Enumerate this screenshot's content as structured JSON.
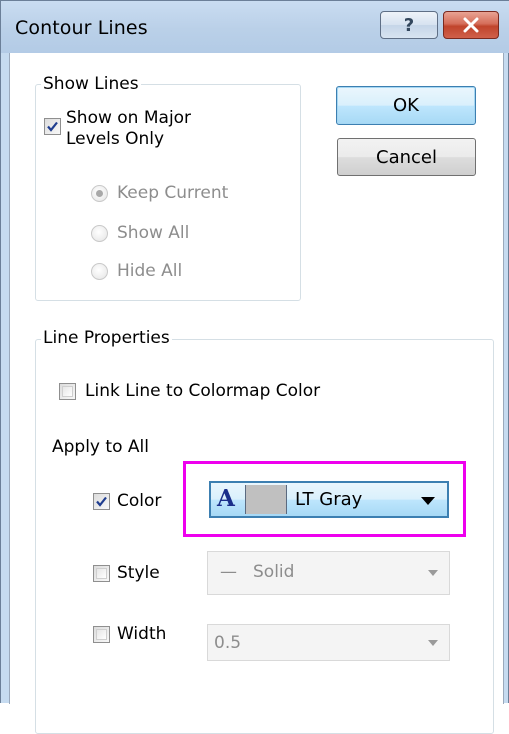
{
  "dialog": {
    "title": "Contour Lines",
    "help_label": "?"
  },
  "show_lines": {
    "group_label": "Show Lines",
    "major_only_line1": "Show on Major",
    "major_only_line2": "Levels Only",
    "major_only_checked": true,
    "radios": [
      {
        "label": "Keep Current",
        "selected": true
      },
      {
        "label": "Show All",
        "selected": false
      },
      {
        "label": "Hide All",
        "selected": false
      }
    ]
  },
  "buttons": {
    "ok": "OK",
    "cancel": "Cancel"
  },
  "line_properties": {
    "group_label": "Line Properties",
    "link_colormap_label": "Link Line to Colormap Color",
    "link_colormap_checked": false,
    "apply_all_label": "Apply to All",
    "color": {
      "label": "Color",
      "checked": true,
      "value": "LT Gray",
      "font_glyph": "A",
      "swatch": "#c0c0c0"
    },
    "style": {
      "label": "Style",
      "checked": false,
      "value": "Solid",
      "line_glyph": "—"
    },
    "width": {
      "label": "Width",
      "checked": false,
      "value": "0.5"
    }
  },
  "colors": {
    "highlight": "#ee00ee",
    "check": "#1f3d8f",
    "disabled_text": "#8d8d8d"
  }
}
